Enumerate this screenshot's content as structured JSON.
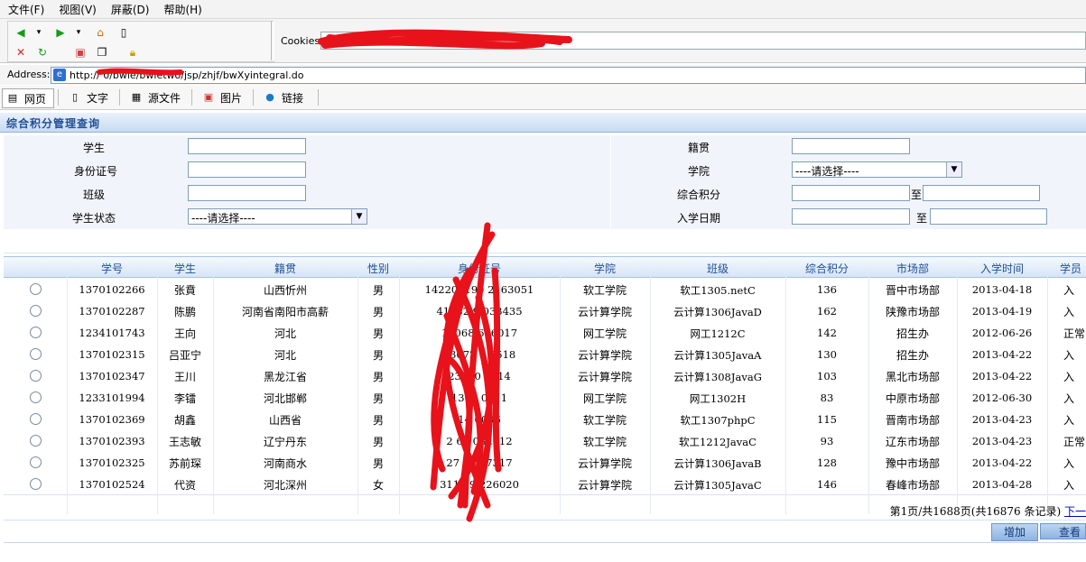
{
  "menu": [
    "文件(F)",
    "视图(V)",
    "屏蔽(D)",
    "帮助(H)"
  ],
  "toolbar": {
    "cookies_label": "Cookies:",
    "cookies_value": ""
  },
  "address": {
    "label": "Address:",
    "url": "http://           0/bwie/bwietwo/jsp/zhjf/bwXyintegral.do"
  },
  "view_tabs": [
    {
      "label": "网页",
      "icon": "page-icon"
    },
    {
      "label": "文字",
      "icon": "text-doc-icon"
    },
    {
      "label": "源文件",
      "icon": "source-icon"
    },
    {
      "label": "图片",
      "icon": "image-icon"
    },
    {
      "label": "链接",
      "icon": "globe-link-icon"
    }
  ],
  "page_title": "综合积分管理查询",
  "form": {
    "student": "学生",
    "id_card": "身份证号",
    "class": "班级",
    "status": "学生状态",
    "native": "籍贯",
    "college": "学院",
    "score": "综合积分",
    "enroll_date": "入学日期",
    "select_placeholder": "----请选择----",
    "to": "至"
  },
  "table": {
    "headers": [
      "学号",
      "学生",
      "籍贯",
      "性别",
      "身份证号",
      "学院",
      "班级",
      "综合积分",
      "市场部",
      "入学时间",
      "学员"
    ],
    "rows": [
      [
        "1370102266",
        "张賁",
        "山西忻州",
        "男",
        "142201199  2163051",
        "软工学院",
        "软工1305.netC",
        "136",
        "晋中市场部",
        "2013-04-18",
        "入"
      ],
      [
        "1370102287",
        "陈鹏",
        "河南省南阳市高薪",
        "男",
        "41132   9  033435",
        "云计算学院",
        "云计算1306JavaD",
        "162",
        "陕豫市场部",
        "2013-04-19",
        "入"
      ],
      [
        "1234101743",
        "王向",
        "河北",
        "男",
        "13068      606017",
        "网工学院",
        "网工1212C",
        "142",
        "招生办",
        "2012-06-26",
        "正常"
      ],
      [
        "1370102315",
        "吕亚宁",
        "河北",
        "男",
        "13072      4 8518",
        "云计算学院",
        "云计算1305JavaA",
        "130",
        "招生办",
        "2013-04-22",
        "入"
      ],
      [
        "1370102347",
        "王川",
        "黑龙江省",
        "男",
        "23900        2014",
        "云计算学院",
        "云计算1308JavaG",
        "103",
        "黑北市场部",
        "2013-04-22",
        "入"
      ],
      [
        "1233101994",
        "李镭",
        "河北邯郸",
        "男",
        "1304        0011",
        "网工学院",
        "网工1302H",
        "83",
        "中原市场部",
        "2012-06-30",
        "入"
      ],
      [
        "1370102369",
        "胡鑫",
        "山西省",
        "男",
        "14         0036",
        "软工学院",
        "软工1307phpC",
        "115",
        "晋南市场部",
        "2013-04-23",
        "入"
      ],
      [
        "1370102393",
        "王志敏",
        "辽宁丹东",
        "男",
        "2  60     082012",
        "软工学院",
        "软工1212JavaC",
        "93",
        "辽东市场部",
        "2013-04-23",
        "正常"
      ],
      [
        "1370102325",
        "苏前琛",
        "河南商水",
        "男",
        "27     9 237317",
        "云计算学院",
        "云计算1306JavaB",
        "128",
        "豫中市场部",
        "2013-04-22",
        "入"
      ],
      [
        "1370102524",
        "代资",
        "河北深州",
        "女",
        "3118    9  226020",
        "云计算学院",
        "云计算1305JavaC",
        "146",
        "春峰市场部",
        "2013-04-28",
        "入"
      ]
    ]
  },
  "pager": {
    "text": "第1页/共1688页(共16876 条记录) ",
    "next": "下一"
  },
  "buttons": {
    "add": "增加",
    "view": "查看"
  }
}
